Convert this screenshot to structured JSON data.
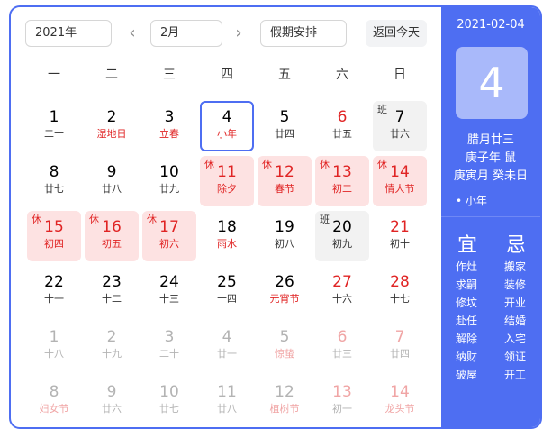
{
  "toolbar": {
    "year": "2021年",
    "month": "2月",
    "holiday_select": "假期安排",
    "prev": "‹",
    "next": "›",
    "today_button": "返回今天"
  },
  "weekdays": [
    "一",
    "二",
    "三",
    "四",
    "五",
    "六",
    "日"
  ],
  "days": [
    {
      "n": "1",
      "s": "二十",
      "weekend": false,
      "redsub": false
    },
    {
      "n": "2",
      "s": "湿地日",
      "redsub": true
    },
    {
      "n": "3",
      "s": "立春",
      "redsub": true
    },
    {
      "n": "4",
      "s": "小年",
      "redsub": true,
      "selected": true
    },
    {
      "n": "5",
      "s": "廿四"
    },
    {
      "n": "6",
      "s": "廿五",
      "weekend": true
    },
    {
      "n": "7",
      "s": "廿六",
      "weekend": false,
      "tag": "班",
      "work": true
    },
    {
      "n": "8",
      "s": "廿七"
    },
    {
      "n": "9",
      "s": "廿八"
    },
    {
      "n": "10",
      "s": "廿九"
    },
    {
      "n": "11",
      "s": "除夕",
      "tag": "休",
      "holiday": true
    },
    {
      "n": "12",
      "s": "春节",
      "tag": "休",
      "holiday": true
    },
    {
      "n": "13",
      "s": "初二",
      "tag": "休",
      "holiday": true
    },
    {
      "n": "14",
      "s": "情人节",
      "tag": "休",
      "holiday": true
    },
    {
      "n": "15",
      "s": "初四",
      "tag": "休",
      "holiday": true
    },
    {
      "n": "16",
      "s": "初五",
      "tag": "休",
      "holiday": true
    },
    {
      "n": "17",
      "s": "初六",
      "tag": "休",
      "holiday": true
    },
    {
      "n": "18",
      "s": "雨水",
      "redsub": true
    },
    {
      "n": "19",
      "s": "初八"
    },
    {
      "n": "20",
      "s": "初九",
      "tag": "班",
      "work": true
    },
    {
      "n": "21",
      "s": "初十",
      "weekend": true
    },
    {
      "n": "22",
      "s": "十一"
    },
    {
      "n": "23",
      "s": "十二"
    },
    {
      "n": "24",
      "s": "十三"
    },
    {
      "n": "25",
      "s": "十四"
    },
    {
      "n": "26",
      "s": "元宵节",
      "redsub": true
    },
    {
      "n": "27",
      "s": "十六",
      "weekend": true
    },
    {
      "n": "28",
      "s": "十七",
      "weekend": true
    },
    {
      "n": "1",
      "s": "十八",
      "other": true
    },
    {
      "n": "2",
      "s": "十九",
      "other": true
    },
    {
      "n": "3",
      "s": "二十",
      "other": true
    },
    {
      "n": "4",
      "s": "廿一",
      "other": true
    },
    {
      "n": "5",
      "s": "惊蛰",
      "other": true,
      "redsub": true
    },
    {
      "n": "6",
      "s": "廿三",
      "other": true,
      "weekend": true
    },
    {
      "n": "7",
      "s": "廿四",
      "other": true,
      "weekend": true
    },
    {
      "n": "8",
      "s": "妇女节",
      "other": true,
      "redsub": true
    },
    {
      "n": "9",
      "s": "廿六",
      "other": true
    },
    {
      "n": "10",
      "s": "廿七",
      "other": true
    },
    {
      "n": "11",
      "s": "廿八",
      "other": true
    },
    {
      "n": "12",
      "s": "植树节",
      "other": true,
      "redsub": true
    },
    {
      "n": "13",
      "s": "初一",
      "other": true,
      "weekend": true
    },
    {
      "n": "14",
      "s": "龙头节",
      "other": true,
      "weekend": true,
      "redsub": true
    }
  ],
  "detail": {
    "date": "2021-02-04",
    "big_day": "4",
    "lunar": "腊月廿三",
    "ganzhi_year": "庚子年 鼠",
    "ganzhi_month_day": "庚寅月 癸未日",
    "festival": "• 小年",
    "yi_title": "宜",
    "ji_title": "忌",
    "yi": [
      "作灶",
      "求嗣",
      "修坟",
      "赴任",
      "解除",
      "纳财",
      "破屋"
    ],
    "ji": [
      "搬家",
      "装修",
      "开业",
      "结婚",
      "入宅",
      "领证",
      "开工"
    ]
  },
  "colors": {
    "accent": "#4e6ef2",
    "holiday_bg": "#fde2e2",
    "red": "#e02424"
  }
}
